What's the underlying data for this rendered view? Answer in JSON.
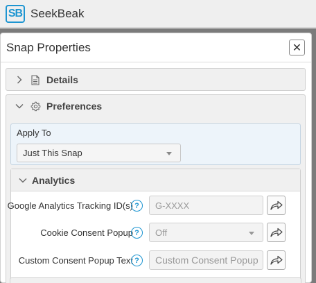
{
  "app": {
    "logo_text": "SB",
    "name": "SeekBeak"
  },
  "dialog": {
    "title": "Snap Properties",
    "close_glyph": "✕"
  },
  "sections": {
    "details": {
      "label": "Details",
      "icon": "document-icon",
      "expanded": false
    },
    "preferences": {
      "label": "Preferences",
      "icon": "gear-icon",
      "expanded": true
    }
  },
  "apply_to": {
    "label": "Apply To",
    "selected": "Just This Snap"
  },
  "analytics": {
    "label": "Analytics",
    "expanded": true,
    "rows": [
      {
        "label": "Google Analytics Tracking ID(s)",
        "help": "?",
        "type": "input",
        "value": "",
        "placeholder": "G-XXXX"
      },
      {
        "label": "Cookie Consent Popup",
        "help": "?",
        "type": "select",
        "value": "Off"
      },
      {
        "label": "Custom Consent Popup Text",
        "help": "?",
        "type": "input",
        "value": "",
        "placeholder": "Custom Consent Popup"
      }
    ]
  },
  "colors": {
    "accent": "#1d95d1",
    "backdrop": "#7b7b7b"
  }
}
